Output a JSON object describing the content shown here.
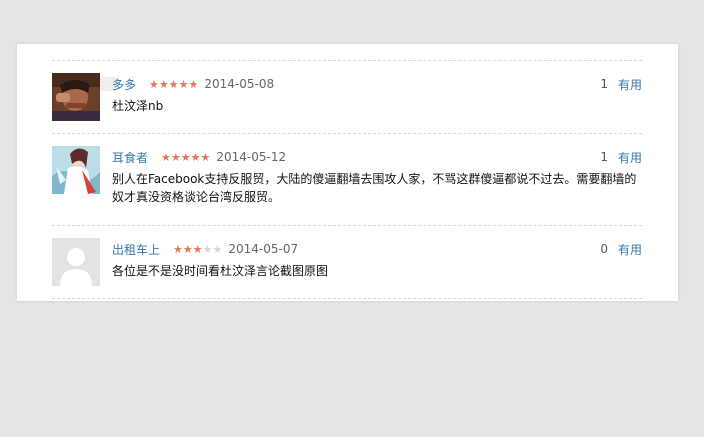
{
  "reviews": [
    {
      "author": "多多",
      "rating": 5,
      "date": "2014-05-08",
      "useful_count": "1",
      "useful_label": "有用",
      "text": "杜汶泽nb",
      "avatar": "person-photo-avatar"
    },
    {
      "author": "耳食者",
      "rating": 5,
      "date": "2014-05-12",
      "useful_count": "1",
      "useful_label": "有用",
      "text": "别人在Facebook支持反服贸，大陆的傻逼翻墙去围攻人家，不骂这群傻逼都说不过去。需要翻墙的奴才真没资格谈论台湾反服贸。",
      "avatar": "anime-illustration-avatar"
    },
    {
      "author": "出租车上",
      "rating": 3,
      "date": "2014-05-07",
      "useful_count": "0",
      "useful_label": "有用",
      "text": "各位是不是没时间看杜汶泽言论截图原图",
      "avatar": "default-user-avatar"
    }
  ],
  "colors": {
    "author": "#3377aa",
    "star_on": "#e2775b",
    "star_off": "#d4d4d4"
  }
}
